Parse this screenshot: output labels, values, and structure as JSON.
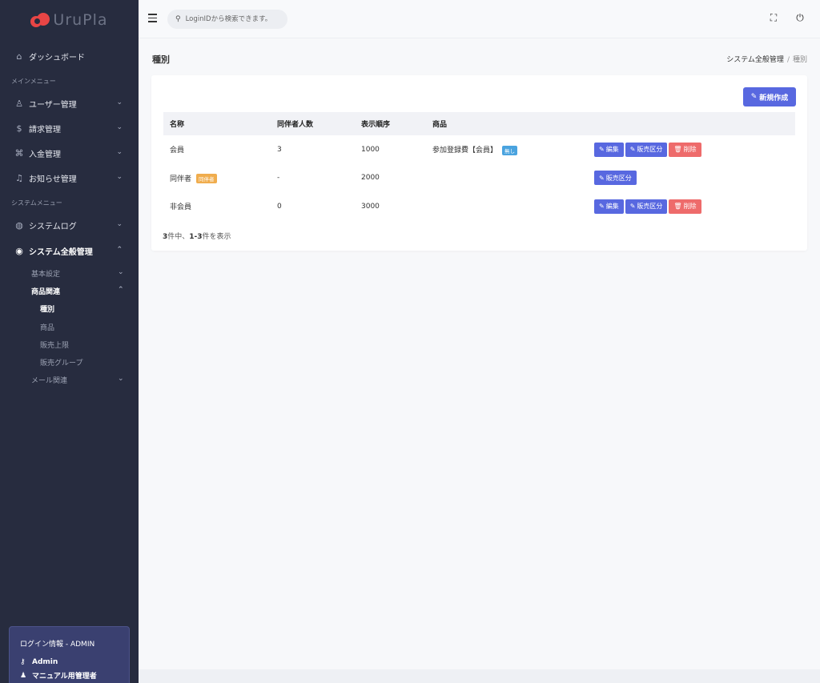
{
  "brand": {
    "name": "UruPla"
  },
  "sidebar": {
    "dashboard": "ダッシュボード",
    "main_menu_label": "メインメニュー",
    "user_mgmt": "ユーザー管理",
    "billing_mgmt": "請求管理",
    "payment_mgmt": "入金管理",
    "notice_mgmt": "お知らせ管理",
    "system_menu_label": "システムメニュー",
    "system_log": "システムログ",
    "system_general": "システム全般管理",
    "basic_settings": "基本設定",
    "product_related": "商品関連",
    "type": "種別",
    "product": "商品",
    "sales_limit": "販売上限",
    "sales_group": "販売グループ",
    "mail_related": "メール関連"
  },
  "login": {
    "title": "ログイン情報 - ADMIN",
    "user": "Admin",
    "role": "マニュアル用管理者"
  },
  "topbar": {
    "search_placeholder": "LoginIDから検索できます。"
  },
  "page": {
    "title": "種別",
    "breadcrumb_parent": "システム全般管理",
    "breadcrumb_sep": "/",
    "breadcrumb_current": "種別",
    "new_button": "新規作成"
  },
  "table": {
    "headers": [
      "名称",
      "同伴者人数",
      "表示順序",
      "商品",
      ""
    ],
    "rows": [
      {
        "name": "会員",
        "badge": "",
        "companions": "3",
        "order": "1000",
        "product": "参加登録費【会員】",
        "product_badge": "無し"
      },
      {
        "name": "同伴者",
        "badge": "同伴者",
        "companions": "-",
        "order": "2000",
        "product": "",
        "product_badge": ""
      },
      {
        "name": "非会員",
        "badge": "",
        "companions": "0",
        "order": "3000",
        "product": "",
        "product_badge": ""
      }
    ],
    "actions": {
      "edit": "編集",
      "sales_category": "販売区分",
      "delete": "削除"
    }
  },
  "summary": {
    "total": "3",
    "mid": "件中、",
    "range": "1-3",
    "suffix": "件を表示"
  }
}
